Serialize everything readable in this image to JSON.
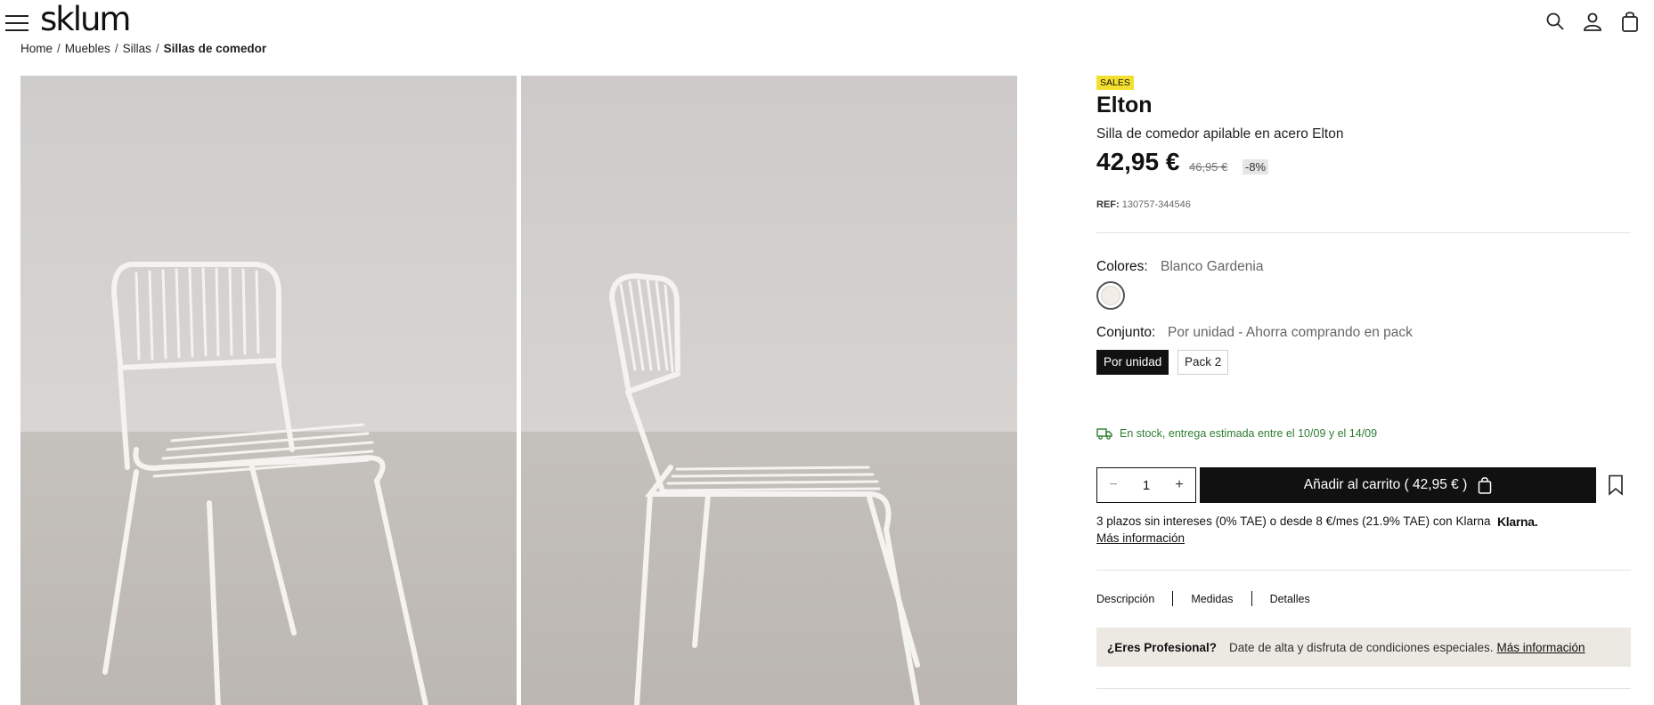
{
  "header": {
    "logo": "sklum",
    "icons": [
      "menu-icon",
      "search-icon",
      "user-icon",
      "cart-icon"
    ]
  },
  "breadcrumb": {
    "items": [
      "Home",
      "Muebles",
      "Sillas",
      "Sillas de comedor"
    ],
    "separator": "/"
  },
  "product": {
    "badge": "SALES",
    "name": "Elton",
    "subtitle": "Silla de comedor apilable en acero Elton",
    "price": "42,95 €",
    "old_price": "46,95 €",
    "discount": "-8%",
    "ref_label": "REF:",
    "ref_value": "130757-344546",
    "colors_label": "Colores:",
    "colors_value": "Blanco Gardenia",
    "swatch_color": "#f2ede7",
    "set_label": "Conjunto:",
    "set_value": "Por unidad - Ahorra comprando en pack",
    "set_options": [
      "Por unidad",
      "Pack 2"
    ],
    "stock_text": "En stock, entrega estimada entre el 10/09 y el 14/09",
    "quantity": "1",
    "minus": "−",
    "plus": "+",
    "add_to_cart": "Añadir al carrito ( 42,95 € )",
    "klarna_text": "3 plazos sin intereses (0% TAE) o desde 8 €/mes (21.9% TAE) con Klarna",
    "klarna_logo": "Klarna.",
    "more_info": "Más información",
    "tabs": [
      "Descripción",
      "Medidas",
      "Detalles"
    ],
    "pro_question": "¿Eres Profesional?",
    "pro_text": "Date de alta y disfruta de condiciones especiales.",
    "pro_link": "Más información"
  },
  "colors": {
    "stock_green": "#2e7d32",
    "badge_yellow": "#f3df2f",
    "pro_bg": "#ece9e3"
  }
}
